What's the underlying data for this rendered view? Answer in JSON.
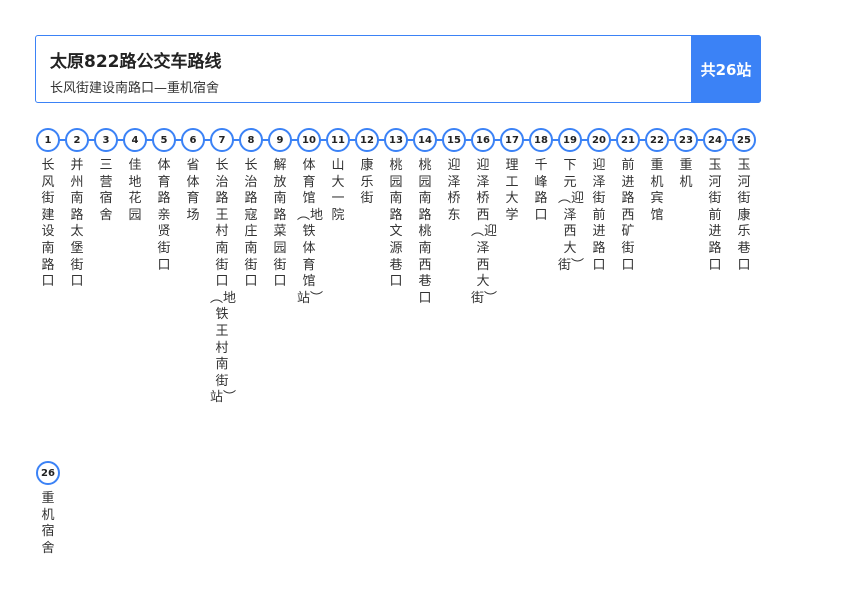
{
  "header": {
    "title": "太原822路公交车路线",
    "subtitle": "长风街建设南路口—重机宿舍",
    "total_label": "共26站"
  },
  "colors": {
    "accent": "#3b82f6"
  },
  "stops": [
    {
      "num": "1",
      "name": "长风街建设南路口"
    },
    {
      "num": "2",
      "name": "并州南路太堡街口"
    },
    {
      "num": "3",
      "name": "三营宿舍"
    },
    {
      "num": "4",
      "name": "佳地花园"
    },
    {
      "num": "5",
      "name": "体育路亲贤街口"
    },
    {
      "num": "6",
      "name": "省体育场"
    },
    {
      "num": "7",
      "name": "长治路王村南街口︵地铁王村南街站︶"
    },
    {
      "num": "8",
      "name": "长治路寇庄南街口"
    },
    {
      "num": "9",
      "name": "解放南路菜园街口"
    },
    {
      "num": "10",
      "name": "体育馆︵地铁体育馆站︶"
    },
    {
      "num": "11",
      "name": "山大一院"
    },
    {
      "num": "12",
      "name": "康乐街"
    },
    {
      "num": "13",
      "name": "桃园南路文源巷口"
    },
    {
      "num": "14",
      "name": "桃园南路桃南西巷口"
    },
    {
      "num": "15",
      "name": "迎泽桥东"
    },
    {
      "num": "16",
      "name": "迎泽桥西︵迎泽西大街︶"
    },
    {
      "num": "17",
      "name": "理工大学"
    },
    {
      "num": "18",
      "name": "千峰路口"
    },
    {
      "num": "19",
      "name": "下元︵迎泽西大街︶"
    },
    {
      "num": "20",
      "name": "迎泽街前进路口"
    },
    {
      "num": "21",
      "name": "前进路西矿街口"
    },
    {
      "num": "22",
      "name": "重机宾馆"
    },
    {
      "num": "23",
      "name": "重机"
    },
    {
      "num": "24",
      "name": "玉河街前进路口"
    },
    {
      "num": "25",
      "name": "玉河街康乐巷口"
    },
    {
      "num": "26",
      "name": "重机宿舍"
    }
  ]
}
